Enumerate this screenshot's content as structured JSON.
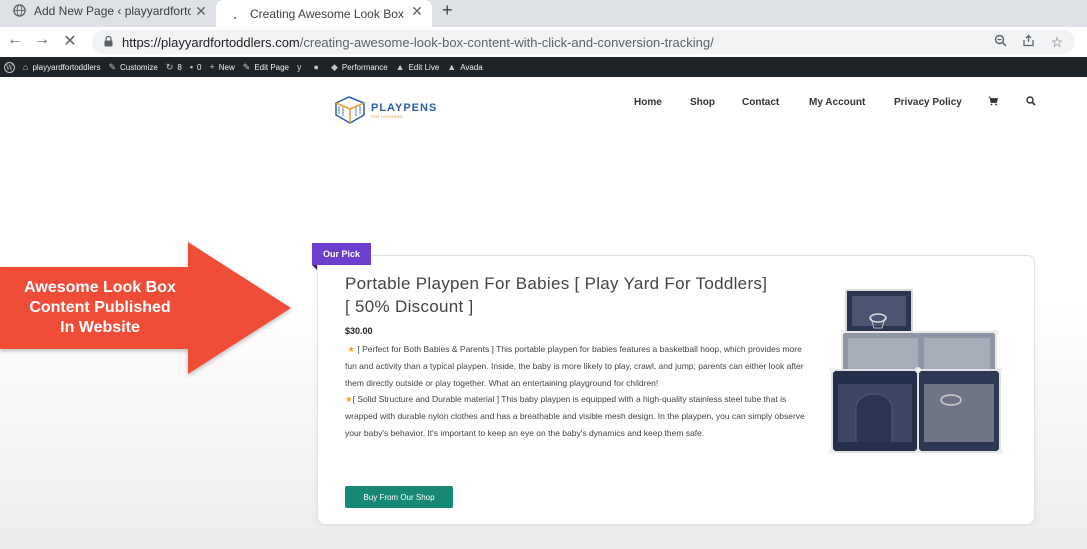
{
  "browser": {
    "tabs": [
      {
        "title": "Add New Page ‹ playyardfortodd",
        "active": false
      },
      {
        "title": "Creating Awesome Look Box Co",
        "active": true
      }
    ],
    "new_tab": "+",
    "url_host": "https://playyardfortoddlers.com",
    "url_path": "/creating-awesome-look-box-content-with-click-and-conversion-tracking/"
  },
  "adminbar": {
    "site_name": "playyardfortoddlers",
    "customize": "Customize",
    "updates": "8",
    "comments": "0",
    "new": "New",
    "edit_page": "Edit Page",
    "performance": "Performance",
    "edit_live": "Edit Live",
    "avada": "Avada"
  },
  "site": {
    "logo_text": "PLAYPENS",
    "logo_tagline": "FOR TODDLERS",
    "nav": [
      "Home",
      "Shop",
      "Contact",
      "My Account",
      "Privacy Policy"
    ]
  },
  "callout": {
    "text_line1": "Awesome Look Box",
    "text_line2": "Content Published",
    "text_line3": "In Website",
    "color": "#f04e37"
  },
  "product": {
    "badge": "Our Pick",
    "title": "Portable Playpen For Babies [ Play Yard For Toddlers] [ 50% Discount ]",
    "price": "$30.00",
    "desc1": "[ Perfect for Both Babies & Parents ] This portable playpen for babies features a basketball hoop, which provides more fun and activity than a typical playpen. Inside, the baby is more likely to play, crawl, and jump; parents can either look after them directly outside or play together. What an entertaining playground for children!",
    "desc2": "[ Solid Structure and Durable material ] This baby playpen is equipped with a high-quality stainless steel tube that is wrapped with durable nylon clothes and has a breathable and visible mesh design. In the playpen, you can simply observe your baby's behavior. It's important to keep an eye on the baby's dynamics and keep them safe.",
    "button": "Buy From Our Shop",
    "star": "★"
  },
  "colors": {
    "badge": "#6d3fcc",
    "button": "#178776",
    "admin_bar": "#1d2327"
  }
}
